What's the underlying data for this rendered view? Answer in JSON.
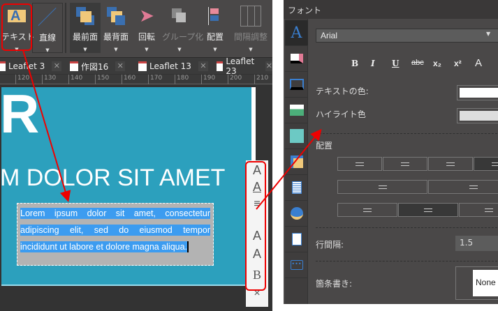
{
  "toolbar": {
    "items": [
      {
        "label": "テキスト"
      },
      {
        "label": "直線"
      },
      {
        "label": "最前面"
      },
      {
        "label": "最背面"
      },
      {
        "label": "回転"
      },
      {
        "label": "グループ化"
      },
      {
        "label": "配置"
      },
      {
        "label": "間隔調整"
      }
    ]
  },
  "tabs": [
    {
      "label": "Leaflet 3"
    },
    {
      "label": "作図16"
    },
    {
      "label": "Leaflet 13"
    },
    {
      "label": "Leaflet 23"
    }
  ],
  "ruler": [
    "120",
    "130",
    "140",
    "150",
    "160",
    "170",
    "180",
    "190",
    "200",
    "210"
  ],
  "canvas": {
    "big_letter": "R",
    "headline": "M DOLOR SIT AMET",
    "text_lines": [
      "Lorem ipsum dolor sit amet, consectetur",
      "adipiscing elit, sed do eiusmod tempor",
      "incididunt ut labore et dolore magna aliqua."
    ]
  },
  "minibar": {
    "font": "A",
    "font_color": "A",
    "align": "≡",
    "grow": "A",
    "shrink": "A",
    "bold": "B",
    "close": "×"
  },
  "panel": {
    "title": "フォント",
    "font_name": "Arial",
    "format_buttons": [
      "B",
      "I",
      "U",
      "abc",
      "x₂",
      "x²",
      "A"
    ],
    "text_color_label": "テキストの色:",
    "highlight_label": "ハイライト色",
    "text_color": "#ffffff",
    "highlight_color": "#dddddd",
    "align_label": "配置",
    "line_spacing_label": "行間隔:",
    "line_spacing": "1.5",
    "bullets_label": "箇条書き:",
    "bullets_value": "None"
  }
}
